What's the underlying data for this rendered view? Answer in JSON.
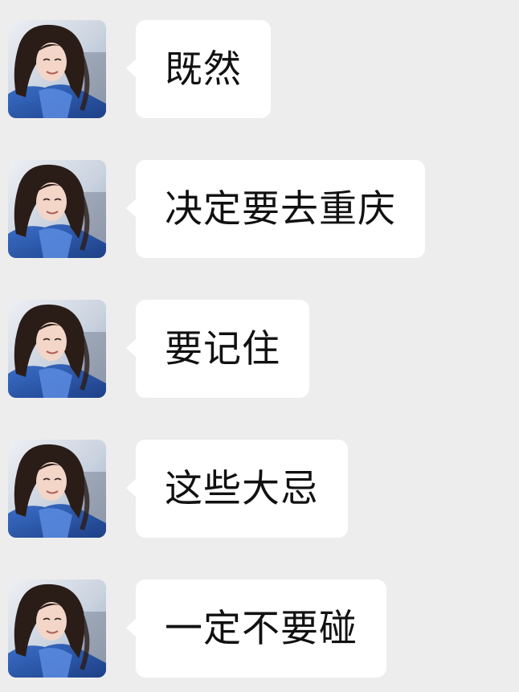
{
  "chat": {
    "messages": [
      {
        "sender": "contact",
        "text": "既然"
      },
      {
        "sender": "contact",
        "text": "决定要去重庆"
      },
      {
        "sender": "contact",
        "text": "要记住"
      },
      {
        "sender": "contact",
        "text": "这些大忌"
      },
      {
        "sender": "contact",
        "text": "一定不要碰"
      }
    ]
  },
  "colors": {
    "background": "#ededed",
    "bubble": "#ffffff",
    "text": "#111111"
  }
}
